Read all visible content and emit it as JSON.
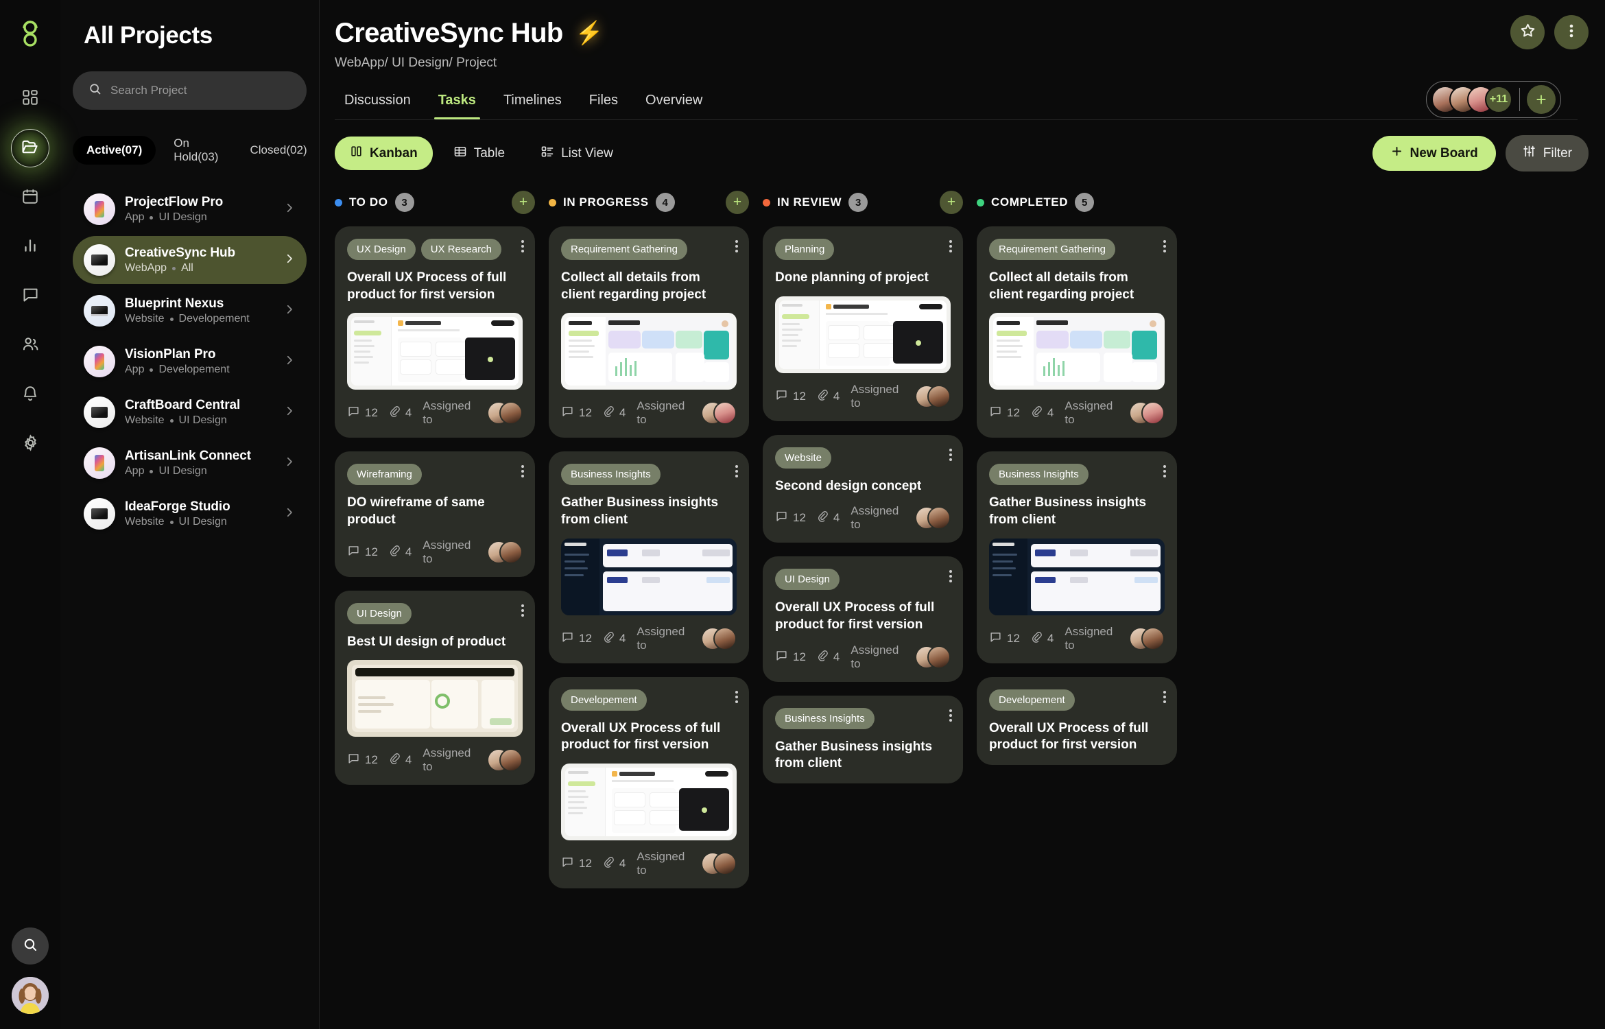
{
  "rail": {
    "logo_icon": "app-logo-icon",
    "nav": [
      {
        "icon": "dashboard-grid-icon",
        "name": "dashboard",
        "active": false
      },
      {
        "icon": "folder-open-icon",
        "name": "projects",
        "active": true
      },
      {
        "icon": "calendar-icon",
        "name": "calendar",
        "active": false
      },
      {
        "icon": "bar-chart-icon",
        "name": "analytics",
        "active": false
      },
      {
        "icon": "chat-bubble-icon",
        "name": "messages",
        "active": false
      },
      {
        "icon": "users-icon",
        "name": "team",
        "active": false
      },
      {
        "icon": "bell-icon",
        "name": "notifications",
        "active": false
      },
      {
        "icon": "gear-icon",
        "name": "settings",
        "active": false
      }
    ],
    "search_icon": "search-icon",
    "avatar_name": "user-avatar"
  },
  "panel": {
    "title": "All Projects",
    "search": {
      "value": "",
      "placeholder": "Search Project",
      "icon": "search-icon"
    },
    "filters": [
      {
        "label": "Active(07)",
        "active": true
      },
      {
        "label": "On Hold(03)",
        "active": false
      },
      {
        "label": "Closed(02)",
        "active": false
      }
    ],
    "projects": [
      {
        "name": "ProjectFlow Pro",
        "type": "App",
        "category": "UI Design",
        "thumb": "phone",
        "selected": false
      },
      {
        "name": "CreativeSync Hub",
        "type": "WebApp",
        "category": "All",
        "thumb": "monitor",
        "selected": true
      },
      {
        "name": "Blueprint Nexus",
        "type": "Website",
        "category": "Developement",
        "thumb": "laptop",
        "selected": false
      },
      {
        "name": "VisionPlan Pro",
        "type": "App",
        "category": "Developement",
        "thumb": "phone",
        "selected": false
      },
      {
        "name": "CraftBoard Central",
        "type": "Website",
        "category": "UI Design",
        "thumb": "monitor",
        "selected": false
      },
      {
        "name": "ArtisanLink Connect",
        "type": "App",
        "category": "UI Design",
        "thumb": "phone",
        "selected": false
      },
      {
        "name": "IdeaForge Studio",
        "type": "Website",
        "category": "UI Design",
        "thumb": "monitor",
        "selected": false
      }
    ]
  },
  "header": {
    "title": "CreativeSync Hub",
    "title_emoji": "⚡",
    "breadcrumb": "WebApp/ UI Design/ Project",
    "star_icon": "star-icon",
    "more_icon": "more-vertical-icon",
    "tabs": [
      {
        "label": "Discussion",
        "active": false
      },
      {
        "label": "Tasks",
        "active": true
      },
      {
        "label": "Timelines",
        "active": false
      },
      {
        "label": "Files",
        "active": false
      },
      {
        "label": "Overview",
        "active": false
      }
    ],
    "members_overflow": "+11",
    "add_member_label": "+"
  },
  "toolbar": {
    "views": [
      {
        "label": "Kanban",
        "icon": "kanban-columns-icon",
        "active": true
      },
      {
        "label": "Table",
        "icon": "table-grid-icon",
        "active": false
      },
      {
        "label": "List View",
        "icon": "list-view-icon",
        "active": false
      }
    ],
    "new_board_label": "New Board",
    "new_board_icon": "plus-icon",
    "filter_label": "Filter",
    "filter_icon": "sliders-icon"
  },
  "board": {
    "columns": [
      {
        "name": "TO DO",
        "count": "3",
        "dot_color": "#3c8ef0",
        "add_icon": "plus-icon",
        "cards": [
          {
            "tags": [
              "UX Design",
              "UX Research"
            ],
            "title": "Overall UX Process of full product for first version",
            "thumb": "statra-insurance-kanban",
            "comments": "12",
            "attachments": "4",
            "assigned_label": "Assigned to",
            "avatars": [
              "f1",
              "f2"
            ]
          },
          {
            "tags": [
              "Wireframing"
            ],
            "title": "DO wireframe of same product",
            "thumb": null,
            "comments": "12",
            "attachments": "4",
            "assigned_label": "Assigned to",
            "avatars": [
              "f1",
              "f2"
            ]
          },
          {
            "tags": [
              "UI Design"
            ],
            "title": "Best UI design of product",
            "thumb": "beige-dashboard",
            "comments": "12",
            "attachments": "4",
            "assigned_label": "Assigned to",
            "avatars": [
              "f1",
              "f2"
            ]
          }
        ]
      },
      {
        "name": "IN PROGRESS",
        "count": "4",
        "dot_color": "#f2b544",
        "add_icon": "plus-icon",
        "cards": [
          {
            "tags": [
              "Requirement Gathering"
            ],
            "title": "Collect all details from client regarding project",
            "thumb": "niond-dashboard",
            "comments": "12",
            "attachments": "4",
            "assigned_label": "Assigned to",
            "avatars": [
              "f1",
              "f3"
            ]
          },
          {
            "tags": [
              "Business Insights"
            ],
            "title": "Gather Business insights from client",
            "thumb": "dark-analytics",
            "comments": "12",
            "attachments": "4",
            "assigned_label": "Assigned to",
            "avatars": [
              "f1",
              "f2"
            ]
          },
          {
            "tags": [
              "Developement"
            ],
            "title": "Overall UX Process of full product for first version",
            "thumb": "statra-insurance-kanban",
            "comments": "12",
            "attachments": "4",
            "assigned_label": "Assigned to",
            "avatars": [
              "f1",
              "f2"
            ]
          }
        ]
      },
      {
        "name": "IN REVIEW",
        "count": "3",
        "dot_color": "#f2683c",
        "add_icon": "plus-icon",
        "cards": [
          {
            "tags": [
              "Planning"
            ],
            "title": "Done planning of project",
            "thumb": "statra-insurance-kanban",
            "comments": "12",
            "attachments": "4",
            "assigned_label": "Assigned to",
            "avatars": [
              "f1",
              "f2"
            ]
          },
          {
            "tags": [
              "Website"
            ],
            "title": "Second design concept",
            "thumb": null,
            "comments": "12",
            "attachments": "4",
            "assigned_label": "Assigned to",
            "avatars": [
              "f1",
              "f2"
            ]
          },
          {
            "tags": [
              "UI Design"
            ],
            "title": "Overall UX Process of full product for first version",
            "thumb": null,
            "comments": "12",
            "attachments": "4",
            "assigned_label": "Assigned to",
            "avatars": [
              "f1",
              "f2"
            ]
          },
          {
            "tags": [
              "Business Insights"
            ],
            "title": "Gather Business insights from client",
            "thumb": null,
            "comments": "",
            "attachments": "",
            "assigned_label": "",
            "avatars": []
          }
        ]
      },
      {
        "name": "COMPLETED",
        "count": "5",
        "dot_color": "#3ed37f",
        "add_icon": "plus-icon",
        "cards": [
          {
            "tags": [
              "Requirement Gathering"
            ],
            "title": "Collect all details from client regarding project",
            "thumb": "niond-dashboard",
            "comments": "12",
            "attachments": "4",
            "assigned_label": "Assigned to",
            "avatars": [
              "f1",
              "f3"
            ]
          },
          {
            "tags": [
              "Business Insights"
            ],
            "title": "Gather Business insights from client",
            "thumb": "dark-analytics",
            "comments": "12",
            "attachments": "4",
            "assigned_label": "Assigned to",
            "avatars": [
              "f1",
              "f2"
            ]
          },
          {
            "tags": [
              "Developement"
            ],
            "title": "Overall UX Process of full product for first version",
            "thumb": null,
            "comments": "",
            "attachments": "",
            "assigned_label": "",
            "avatars": []
          }
        ]
      }
    ]
  },
  "colors": {
    "accent": "#c5ec86",
    "accent_soft": "#4f5733",
    "card_bg": "#2b2d27",
    "tag_bg": "#777f68",
    "selected_project": "#4d542f"
  }
}
